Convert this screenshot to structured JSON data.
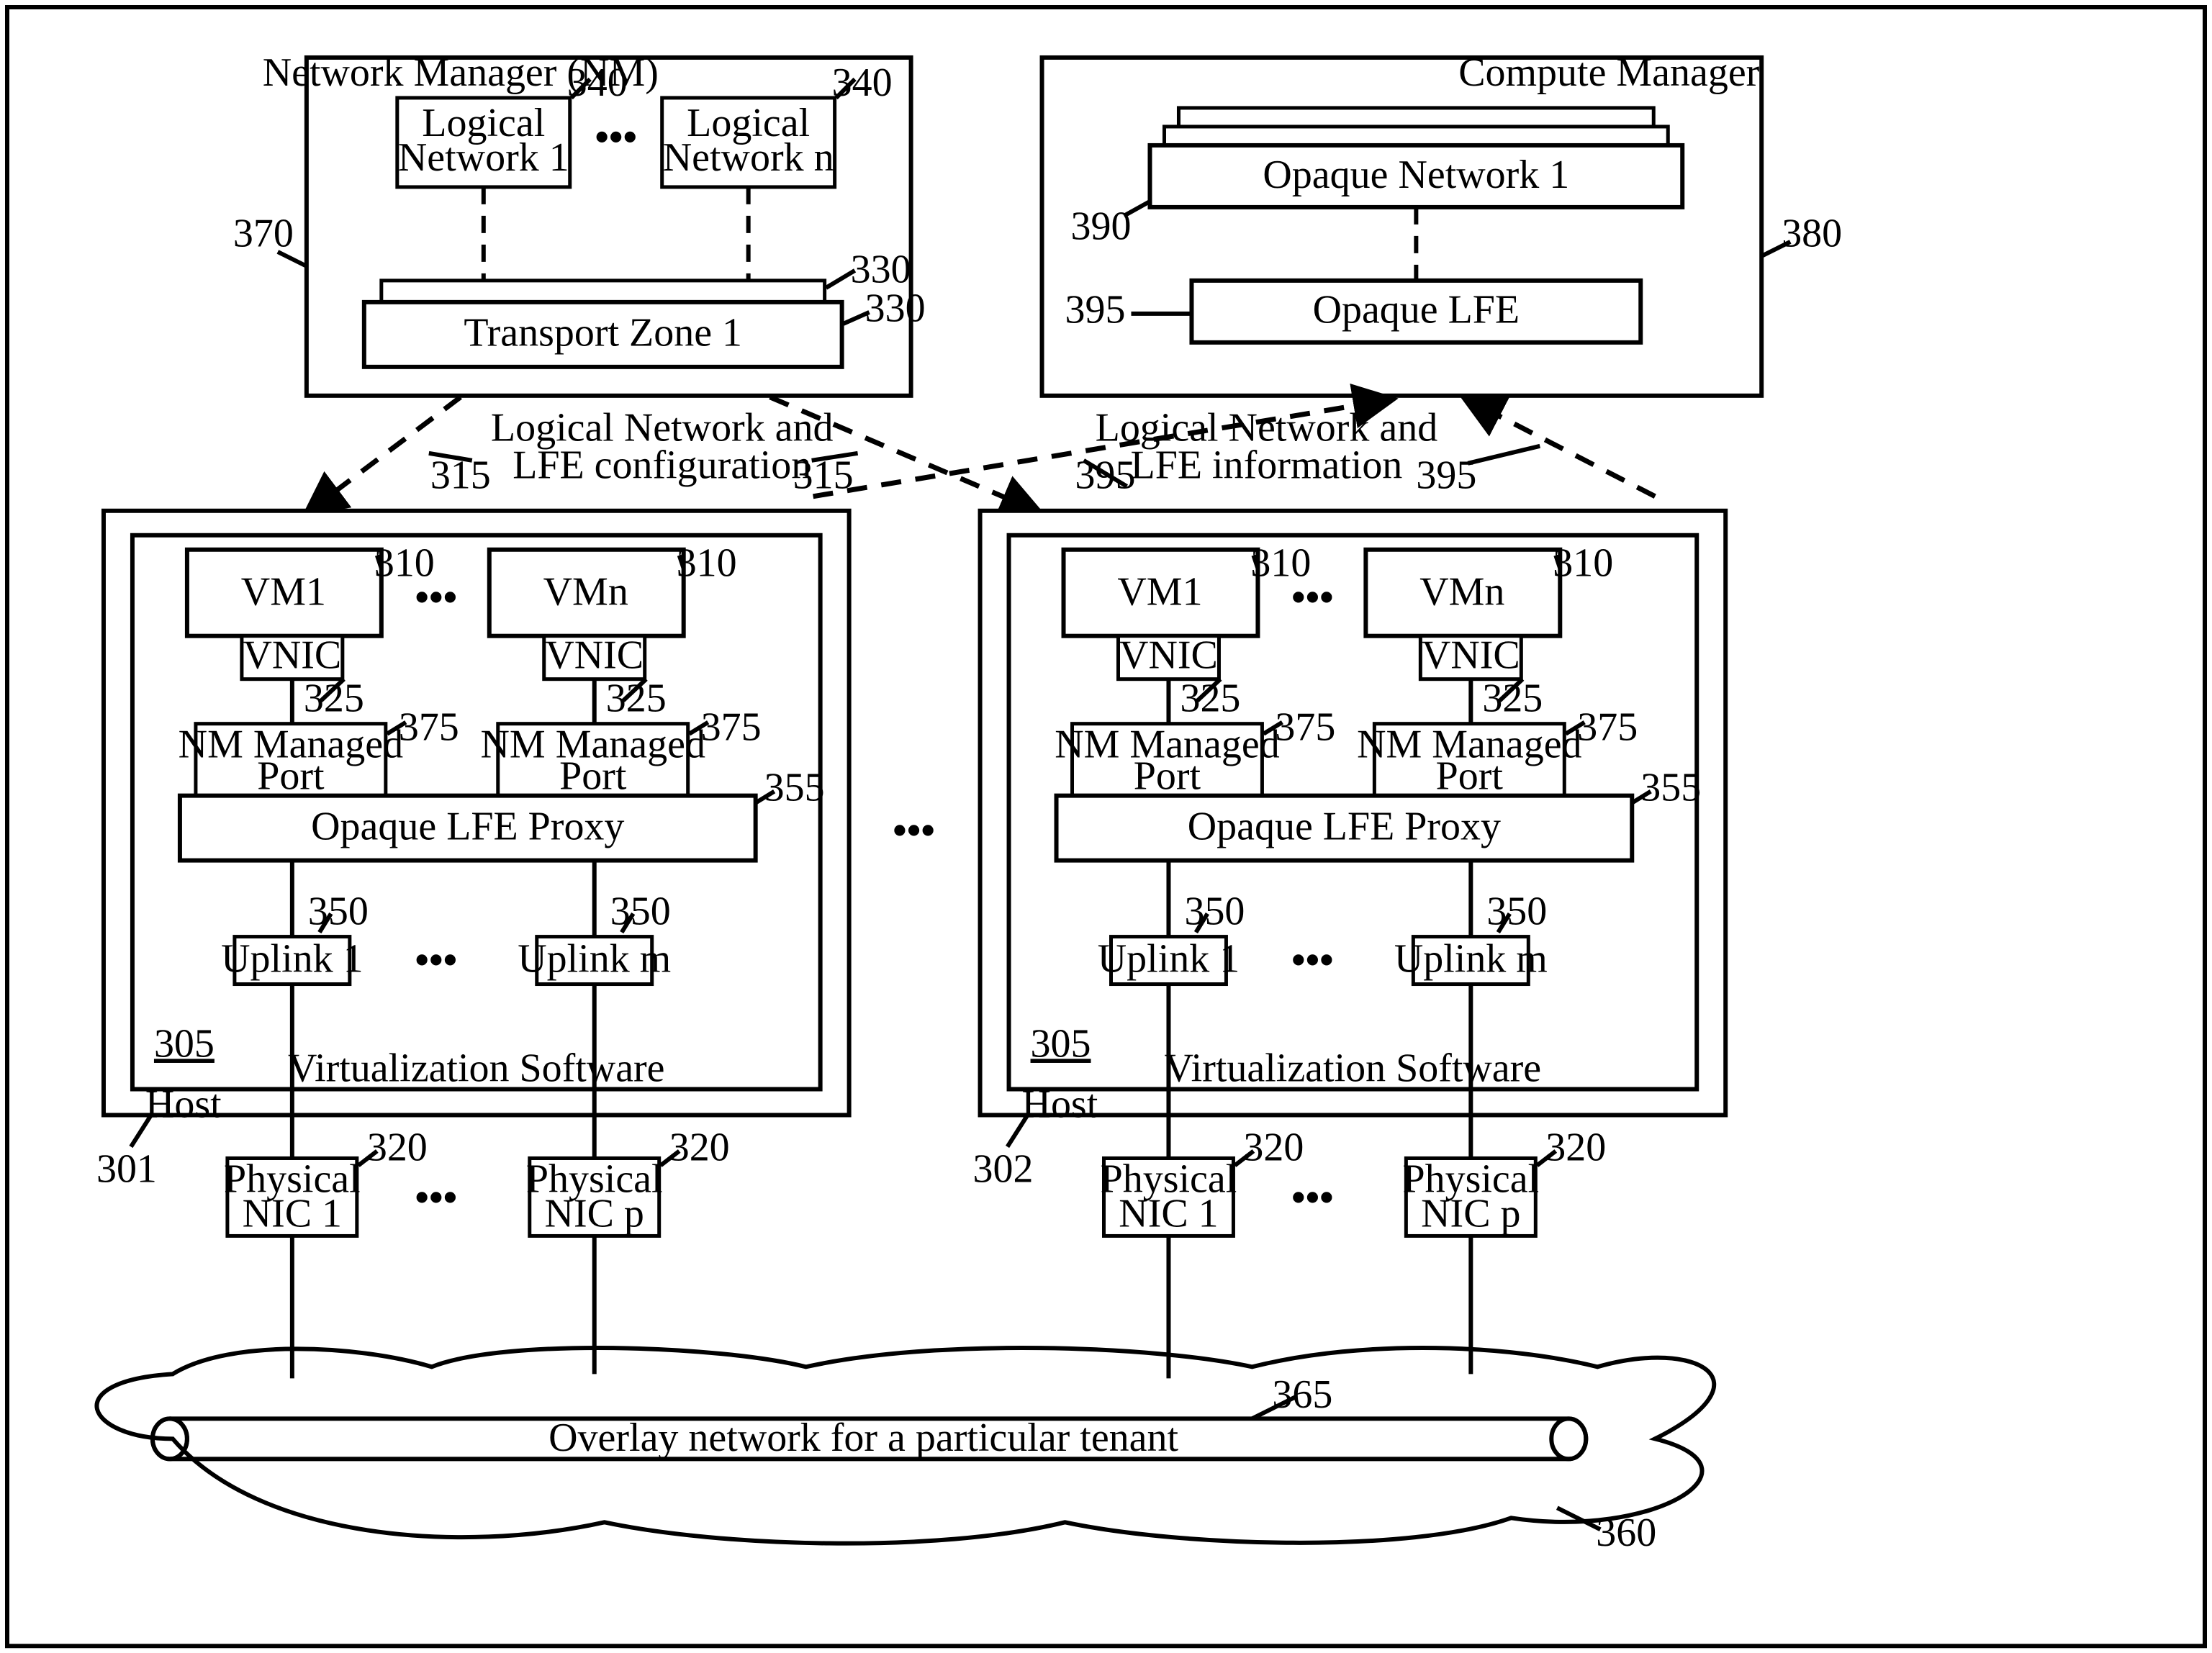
{
  "nm": {
    "title": "Network Manager (NM)",
    "ln1": "Logical\nNetwork 1",
    "lnn": "Logical\nNetwork n",
    "tz": "Transport Zone 1",
    "ref": "370",
    "ln_ref": "340",
    "tz_ref": "330"
  },
  "cm": {
    "title": "Compute Manager",
    "on": "Opaque Network 1",
    "olfe": "Opaque LFE",
    "ref": "380",
    "on_ref": "390",
    "olfe_ref": "395"
  },
  "mid_labels": {
    "left": "Logical Network and\nLFE configuration",
    "right": "Logical Network and\nLFE information",
    "ref_315": "315",
    "ref_395": "395"
  },
  "host": {
    "label": "Host",
    "vs": "Virtualization Software",
    "ref_vs": "305",
    "ref_host1": "301",
    "ref_host2": "302",
    "vm1": "VM1",
    "vmn": "VMn",
    "vm_ref": "310",
    "vnic": "VNIC",
    "vnic_ref": "325",
    "port": "NM Managed\nPort",
    "port_ref": "375",
    "proxy": "Opaque LFE Proxy",
    "proxy_ref": "355",
    "up1": "Uplink 1",
    "upm": "Uplink m",
    "up_ref": "350",
    "pnic1": "Physical\nNIC 1",
    "pnicp": "Physical\nNIC p",
    "pnic_ref": "320"
  },
  "overlay": {
    "label": "Overlay network for a particular tenant",
    "tube_ref": "365",
    "cloud_ref": "360"
  },
  "dots": "• • •"
}
